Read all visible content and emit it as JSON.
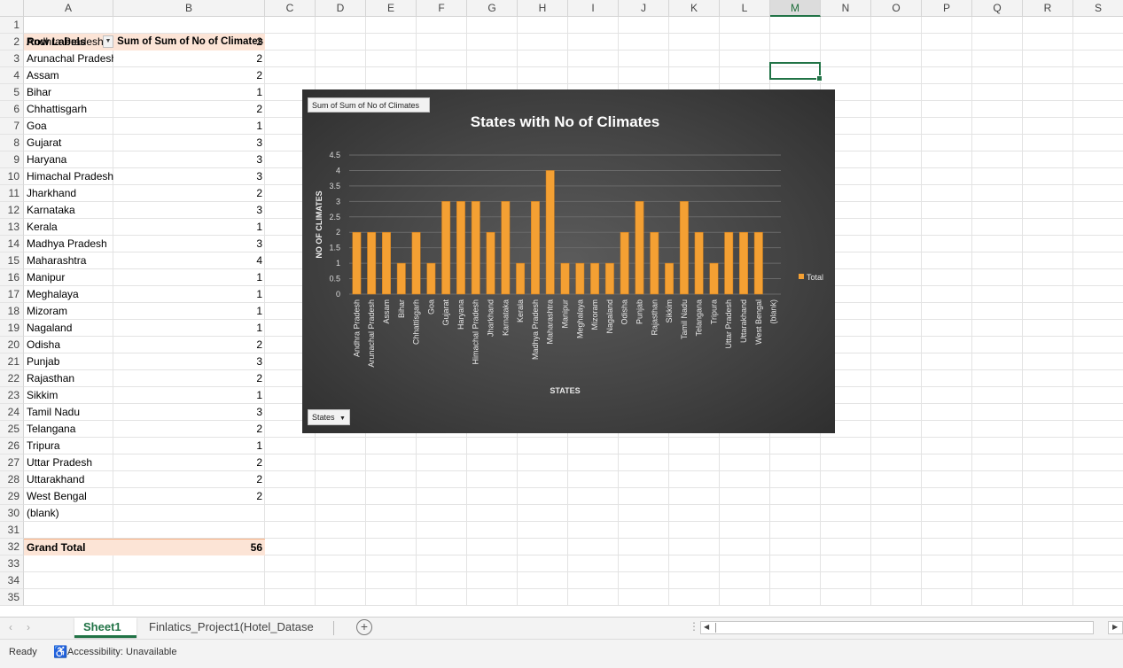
{
  "columns": [
    "A",
    "B",
    "C",
    "D",
    "E",
    "F",
    "G",
    "H",
    "I",
    "J",
    "K",
    "L",
    "M",
    "N",
    "O",
    "P",
    "Q",
    "R",
    "S"
  ],
  "selected_column": "M",
  "row_count": 35,
  "pivot": {
    "header_label": "Row Labels",
    "header_value": "Sum of Sum of No of Climates",
    "filter_icon": "dropdown-arrow-icon",
    "rows": [
      {
        "label": "Andhra Pradesh",
        "value": "2"
      },
      {
        "label": "Arunachal Pradesh",
        "value": "2"
      },
      {
        "label": "Assam",
        "value": "2"
      },
      {
        "label": "Bihar",
        "value": "1"
      },
      {
        "label": "Chhattisgarh",
        "value": "2"
      },
      {
        "label": "Goa",
        "value": "1"
      },
      {
        "label": "Gujarat",
        "value": "3"
      },
      {
        "label": "Haryana",
        "value": "3"
      },
      {
        "label": "Himachal Pradesh",
        "value": "3"
      },
      {
        "label": "Jharkhand",
        "value": "2"
      },
      {
        "label": "Karnataka",
        "value": "3"
      },
      {
        "label": "Kerala",
        "value": "1"
      },
      {
        "label": "Madhya Pradesh",
        "value": "3"
      },
      {
        "label": "Maharashtra",
        "value": "4"
      },
      {
        "label": "Manipur",
        "value": "1"
      },
      {
        "label": "Meghalaya",
        "value": "1"
      },
      {
        "label": "Mizoram",
        "value": "1"
      },
      {
        "label": "Nagaland",
        "value": "1"
      },
      {
        "label": "Odisha",
        "value": "2"
      },
      {
        "label": "Punjab",
        "value": "3"
      },
      {
        "label": "Rajasthan",
        "value": "2"
      },
      {
        "label": "Sikkim",
        "value": "1"
      },
      {
        "label": "Tamil Nadu",
        "value": "3"
      },
      {
        "label": "Telangana",
        "value": "2"
      },
      {
        "label": "Tripura",
        "value": "1"
      },
      {
        "label": "Uttar Pradesh",
        "value": "2"
      },
      {
        "label": "Uttarakhand",
        "value": "2"
      },
      {
        "label": "West Bengal",
        "value": "2"
      },
      {
        "label": "(blank)",
        "value": ""
      }
    ],
    "grand_total_label": "Grand Total",
    "grand_total_value": "56"
  },
  "chart_data": {
    "type": "bar",
    "title": "States with No of Climates",
    "xlabel": "STATES",
    "ylabel": "NO OF CLIMATES",
    "value_field_button": "Sum of Sum of No of Climates",
    "axis_field_button": "States",
    "ylim": [
      0,
      4.5
    ],
    "yticks": [
      "0",
      "0.5",
      "1",
      "1.5",
      "2",
      "2.5",
      "3",
      "3.5",
      "4",
      "4.5"
    ],
    "grid": true,
    "legend": "right",
    "bar_color": "#f4a033",
    "categories": [
      "Andhra Pradesh",
      "Arunachal Pradesh",
      "Assam",
      "Bihar",
      "Chhattisgarh",
      "Goa",
      "Gujarat",
      "Haryana",
      "Himachal Pradesh",
      "Jharkhand",
      "Karnataka",
      "Kerala",
      "Madhya Pradesh",
      "Maharashtra",
      "Manipur",
      "Meghalaya",
      "Mizoram",
      "Nagaland",
      "Odisha",
      "Punjab",
      "Rajasthan",
      "Sikkim",
      "Tamil Nadu",
      "Telangana",
      "Tripura",
      "Uttar Pradesh",
      "Uttarakhand",
      "West Bengal",
      "(blank)"
    ],
    "series": [
      {
        "name": "Total",
        "values": [
          2,
          2,
          2,
          1,
          2,
          1,
          3,
          3,
          3,
          2,
          3,
          1,
          3,
          4,
          1,
          1,
          1,
          1,
          2,
          3,
          2,
          1,
          3,
          2,
          1,
          2,
          2,
          2,
          null
        ]
      }
    ]
  },
  "tabs": {
    "items": [
      "Sheet1",
      "Finlatics_Project1(Hotel_Datase"
    ],
    "active": 0,
    "add_icon": "plus-circle-icon"
  },
  "status": {
    "ready": "Ready",
    "accessibility": "Accessibility: Unavailable"
  },
  "colors": {
    "accent": "#217346",
    "pivot_header_fill": "#fce4d6",
    "bar": "#f4a033"
  }
}
